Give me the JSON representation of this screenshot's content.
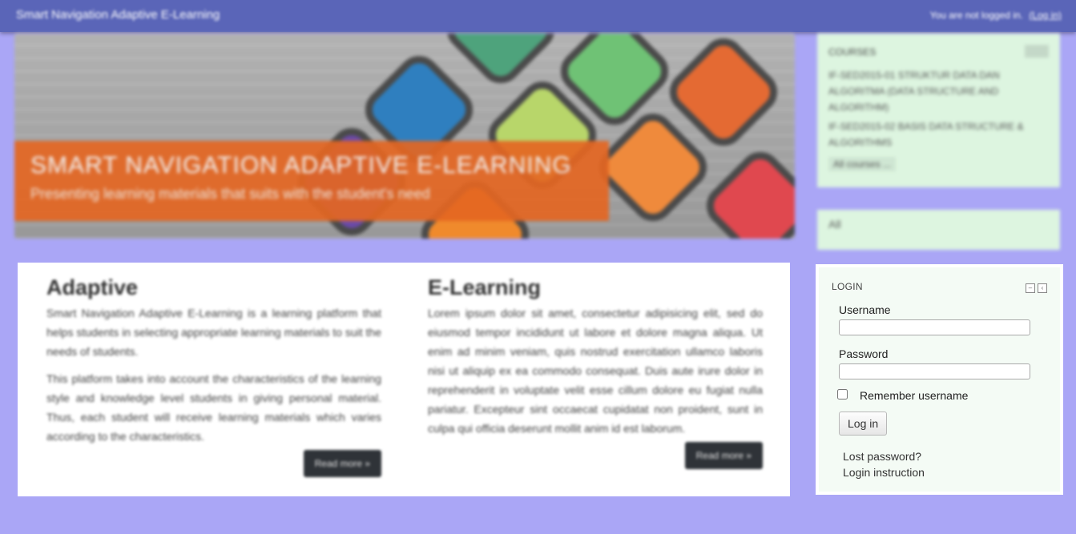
{
  "navbar": {
    "brand": "Smart Navigation Adaptive E-Learning",
    "login_status": "You are not logged in.",
    "login_link": "(Log in)"
  },
  "hero": {
    "title": "SMART NAVIGATION ADAPTIVE E-LEARNING",
    "subtitle": "Presenting learning materials that suits with the student's need",
    "badges": [
      {
        "icon": "lightbulb-head-icon",
        "color": "#2f7fbf"
      },
      {
        "icon": "checkmark-icon",
        "color": "#6fc275"
      },
      {
        "icon": "speech-bubble-hello-icon",
        "color": "#e46a33"
      },
      {
        "icon": "books-icon",
        "color": "#b8d66a"
      },
      {
        "icon": "people-group-icon",
        "color": "#ef8a3c"
      },
      {
        "icon": "grade-a-plus-icon",
        "color": "#e0484f"
      },
      {
        "icon": "computer-icon",
        "color": "#4ea37c"
      }
    ]
  },
  "sections": [
    {
      "title": "Adaptive",
      "paragraphs": [
        "Smart Navigation Adaptive E-Learning is a learning platform that helps students in selecting appropriate learning materials to suit the needs of students.",
        "This platform takes into account the characteristics of the learning style and knowledge level students in giving personal material. Thus, each student will receive learning materials which varies according to the characteristics."
      ],
      "button": "Read more »"
    },
    {
      "title": "E-Learning",
      "paragraphs": [
        "Lorem ipsum dolor sit amet, consectetur adipisicing elit, sed do eiusmod tempor incididunt ut labore et dolore magna aliqua. Ut enim ad minim veniam, quis nostrud exercitation ullamco laboris nisi ut aliquip ex ea commodo consequat. Duis aute irure dolor in reprehenderit in voluptate velit esse cillum dolore eu fugiat nulla pariatur. Excepteur sint occaecat cupidatat non proident, sunt in culpa qui officia deserunt mollit anim id est laborum."
      ],
      "button": "Read more »"
    }
  ],
  "courses_block": {
    "header": "COURSES",
    "items": [
      "IF-SED2015-01 STRUKTUR DATA DAN ALGORITMA (DATA STRUCTURE AND ALGORITHM)",
      "IF-SED2015-02 BASIS DATA STRUCTURE & ALGORITHMS"
    ],
    "all_link": "All courses ..."
  },
  "second_block": {
    "text": "All"
  },
  "login_block": {
    "header": "LOGIN",
    "username_label": "Username",
    "password_label": "Password",
    "remember_label": "Remember username",
    "login_button": "Log in",
    "lost_password": "Lost password?",
    "login_instruction": "Login instruction"
  },
  "colors": {
    "background": "#aaa6f6",
    "navbar": "#5a65b8",
    "caption_orange": "#e46622",
    "sidebar_block": "#ddf5e0"
  }
}
